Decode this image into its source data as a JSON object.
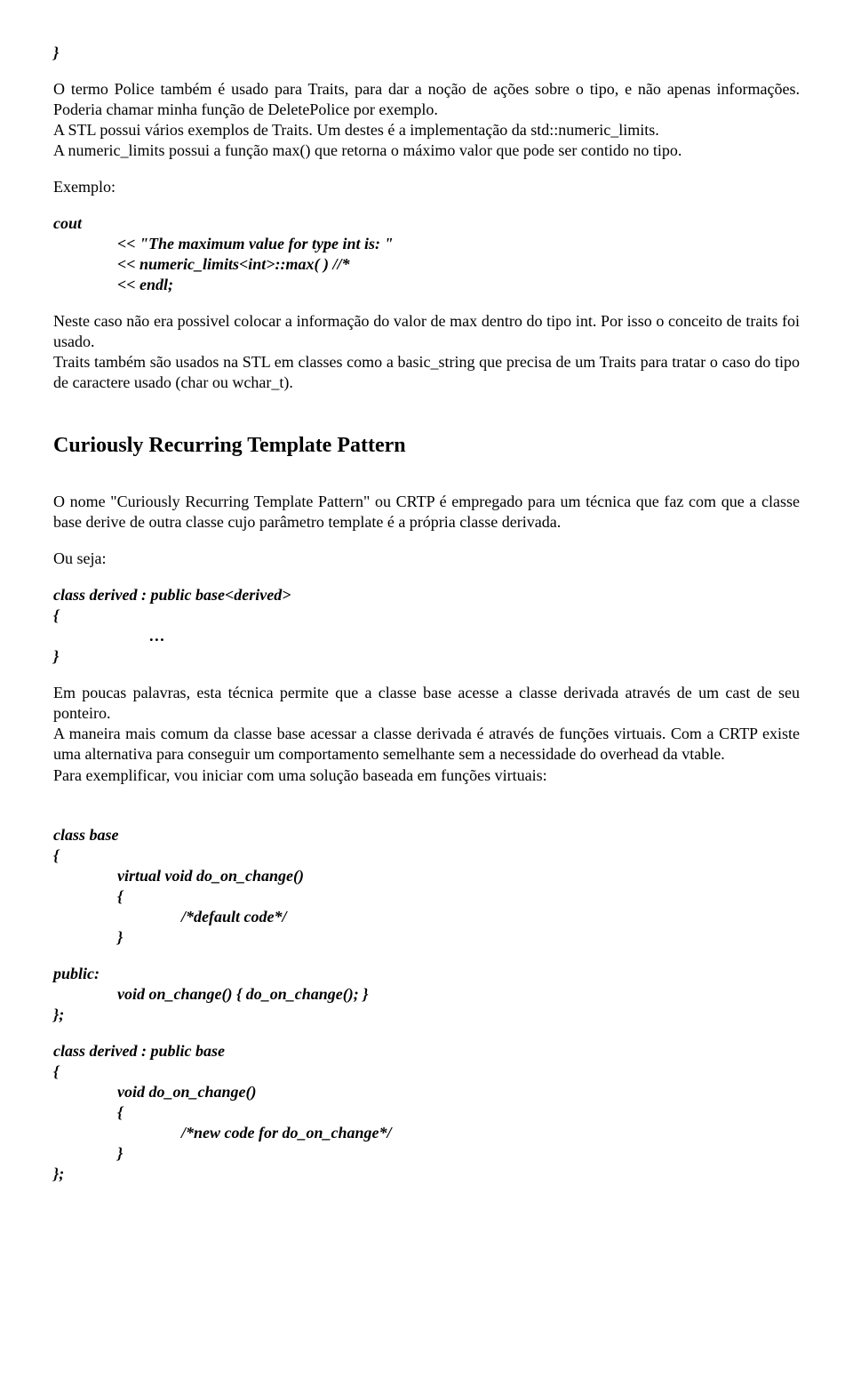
{
  "top_brace": "}",
  "para1": "O termo Police também é usado para Traits, para dar a noção de ações sobre o tipo, e não apenas informações. Poderia chamar minha função de DeletePolice por exemplo.",
  "para2": "A STL possui vários exemplos de Traits. Um destes é a implementação da std::numeric_limits.",
  "para3": "A numeric_limits possui a função max() que retorna o máximo valor que pode ser contido no tipo.",
  "exemplo_label": "Exemplo:",
  "cout_label": "cout",
  "cout_l1": "<< \"The maximum value for type int is:  \"",
  "cout_l2": " << numeric_limits<int>::max( ) //*",
  "cout_l3": "<< endl;",
  "para4": "Neste caso não era possivel colocar a informação do valor de max dentro do tipo int. Por isso o conceito de traits foi usado.",
  "para5": "Traits também são usados na STL em classes como a basic_string que precisa de um Traits para tratar o caso do tipo de caractere usado (char ou wchar_t).",
  "section_title": "Curiously Recurring Template Pattern",
  "crtp_para1": "O nome \"Curiously Recurring Template Pattern\" ou CRTP é empregado para um técnica que faz com que a classe base derive de outra classe cujo parâmetro template é a própria classe derivada.",
  "ou_seja": "Ou seja:",
  "code1_l1": "class derived : public base<derived>",
  "code1_l2": "{",
  "code1_l3": "…",
  "code1_l4": "}",
  "crtp_para2": "Em poucas palavras, esta técnica permite que a classe base acesse a classe derivada através de um cast de seu ponteiro.",
  "crtp_para3": "A maneira mais comum da classe base acessar a classe derivada é através de funções virtuais. Com a CRTP existe uma alternativa para conseguir um comportamento semelhante sem a necessidade do overhead da vtable.",
  "crtp_para4": "Para exemplificar, vou iniciar com uma solução baseada em funções virtuais:",
  "code2": {
    "l1": "class base",
    "l2": "{",
    "l3": "virtual void do_on_change()",
    "l4": "{",
    "l5": "/*default code*/",
    "l6": "}",
    "public": "public:",
    "l7": "void on_change() { do_on_change(); }",
    "l8": "};",
    "d1": "class derived : public base",
    "d2": "{",
    "d3": "void do_on_change()",
    "d4": "{",
    "d5": "/*new code for do_on_change*/",
    "d6": "}",
    "d7": "};"
  }
}
